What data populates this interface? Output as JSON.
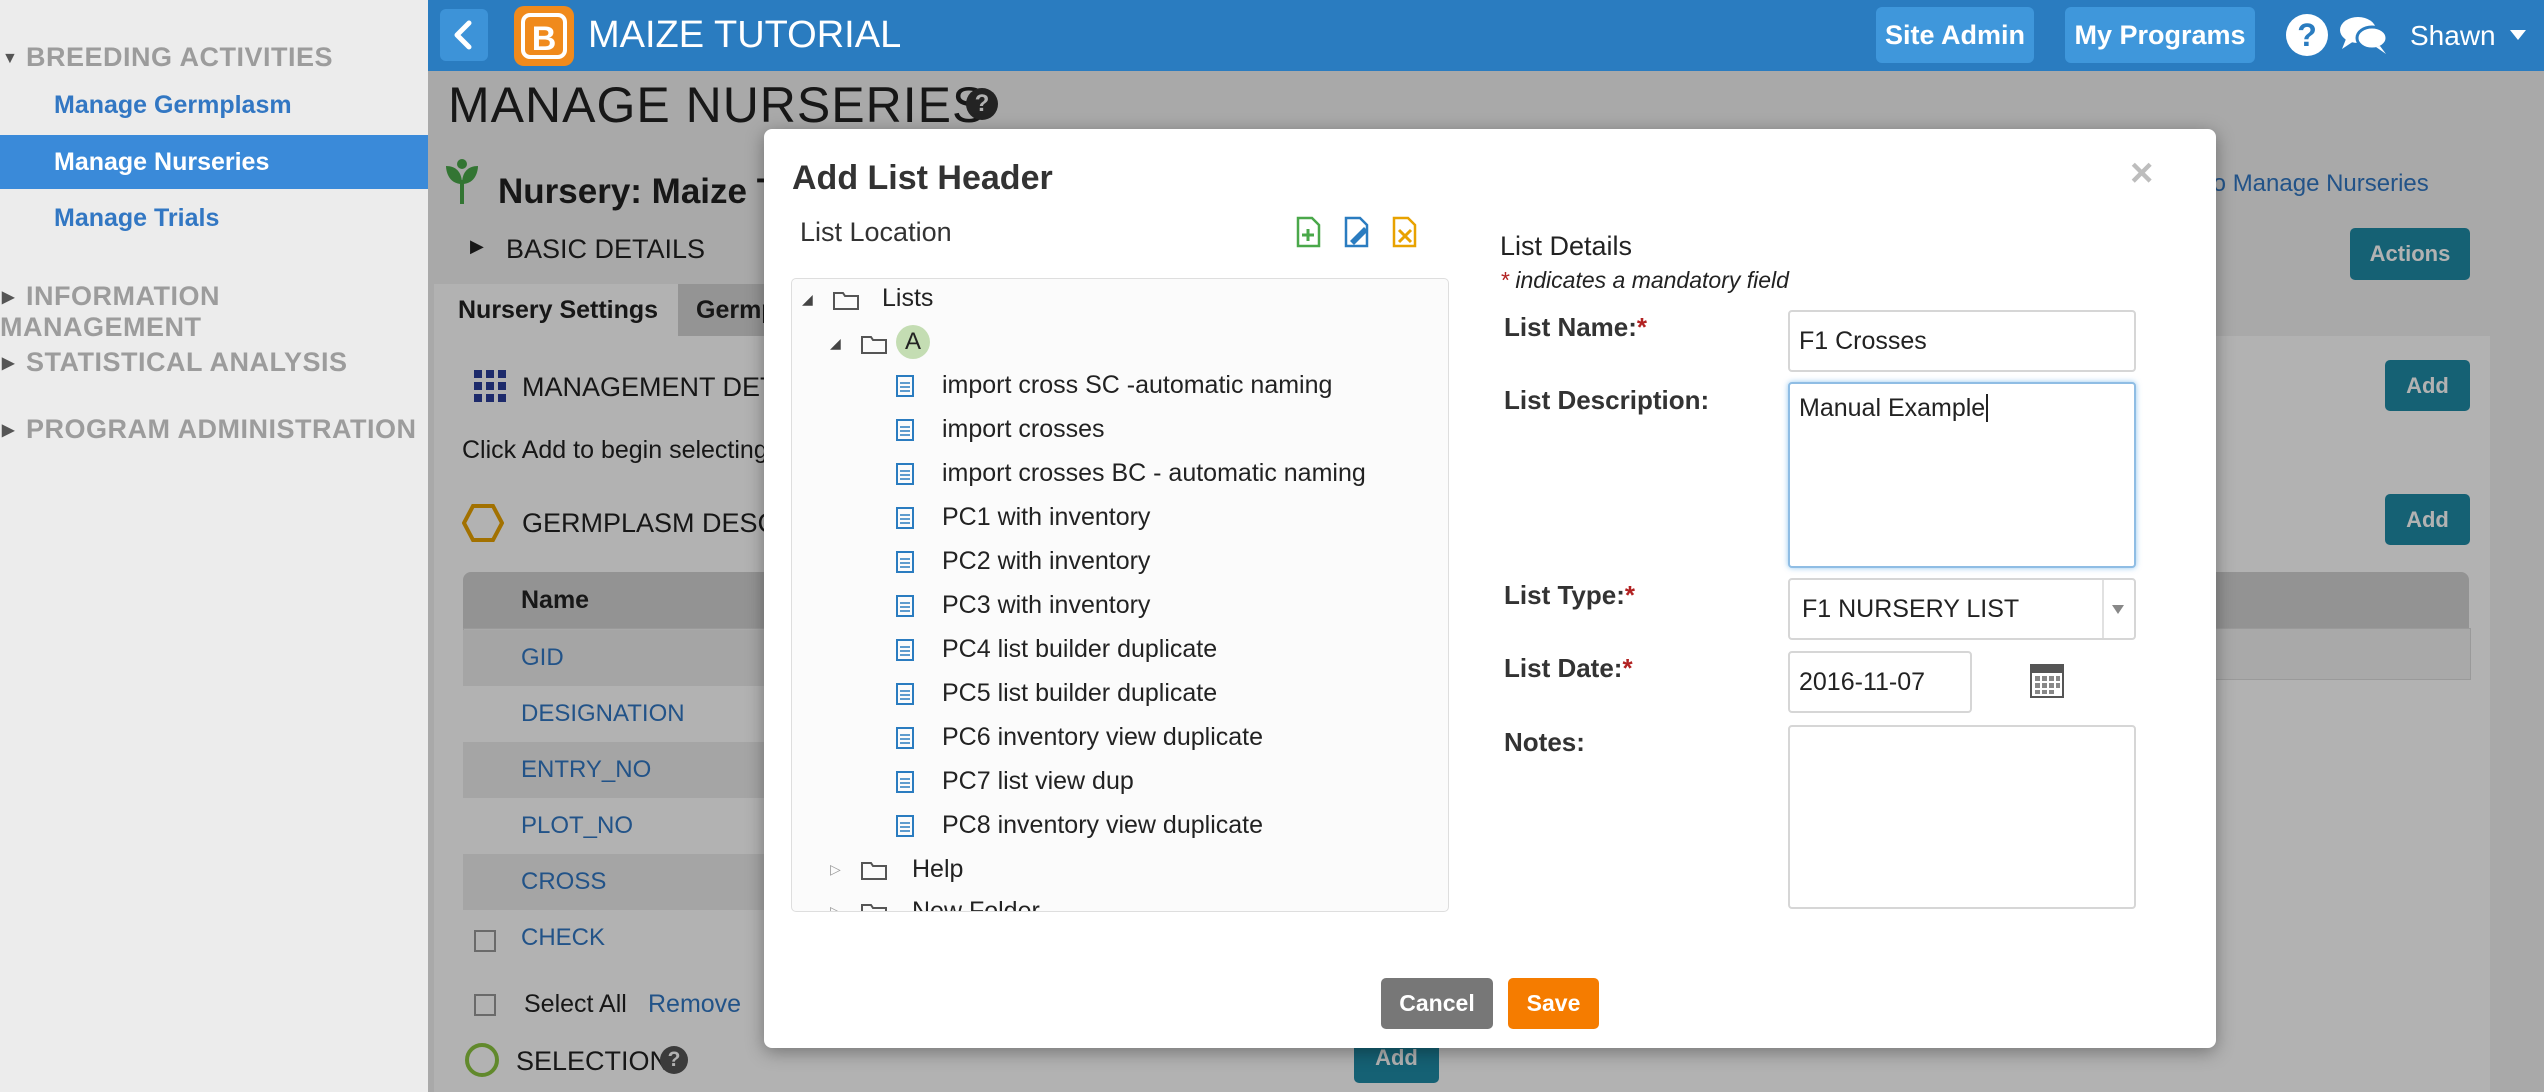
{
  "sidebar": {
    "sections": [
      {
        "label": "BREEDING ACTIVITIES",
        "expanded": true
      },
      {
        "label": "INFORMATION MANAGEMENT",
        "expanded": false
      },
      {
        "label": "STATISTICAL ANALYSIS",
        "expanded": false
      },
      {
        "label": "PROGRAM ADMINISTRATION",
        "expanded": false
      }
    ],
    "items": [
      "Manage Germplasm",
      "Manage Nurseries",
      "Manage Trials"
    ],
    "active_item": "Manage Nurseries"
  },
  "topbar": {
    "app_title": "MAIZE TUTORIAL",
    "site_admin": "Site Admin",
    "my_programs": "My Programs",
    "help_glyph": "?",
    "user": "Shawn",
    "logo_letter": "B"
  },
  "page": {
    "title": "MANAGE NURSERIES",
    "nursery_title": "Nursery: Maize T",
    "return_link": "rn to Manage Nurseries",
    "basic_details": "BASIC DETAILS",
    "actions_button": "Actions",
    "tabs": [
      "Nursery Settings",
      "Germp"
    ],
    "management_details": "MANAGEMENT DETA",
    "click_add": "Click Add to begin selecting",
    "add_button": "Add",
    "germplasm_descriptors": "GERMPLASM DESCR",
    "table_header": "Name",
    "table_rows": [
      "GID",
      "DESIGNATION",
      "ENTRY_NO",
      "PLOT_NO",
      "CROSS",
      "CHECK"
    ],
    "select_all": "Select All",
    "remove": "Remove",
    "selection": "SELECTION"
  },
  "modal": {
    "title": "Add List Header",
    "close_glyph": "×",
    "list_location_label": "List Location",
    "toolbar_icons": [
      "add-folder-icon",
      "rename-folder-icon",
      "delete-folder-icon"
    ],
    "tree": {
      "root": "Lists",
      "folder_a": "A",
      "files": [
        "import cross SC -automatic naming",
        "import crosses",
        "import crosses BC - automatic naming",
        "PC1 with inventory",
        "PC2 with inventory",
        "PC3 with inventory",
        "PC4 list builder duplicate",
        "PC5 list builder duplicate",
        "PC6 inventory view duplicate",
        "PC7 list view dup",
        "PC8 inventory view duplicate"
      ],
      "other_folders": [
        "Help",
        "New Folder"
      ]
    },
    "details_header": "List Details",
    "mandatory_note_star": "*",
    "mandatory_note": " indicates a mandatory field",
    "fields": {
      "name_label": "List Name:",
      "name_value": "F1 Crosses",
      "description_label": "List Description:",
      "description_value": "Manual Example",
      "type_label": "List Type:",
      "type_value": "F1 NURSERY LIST",
      "date_label": "List Date:",
      "date_value": "2016-11-07",
      "notes_label": "Notes:",
      "notes_value": ""
    },
    "required_star": "*",
    "cancel_button": "Cancel",
    "save_button": "Save"
  }
}
